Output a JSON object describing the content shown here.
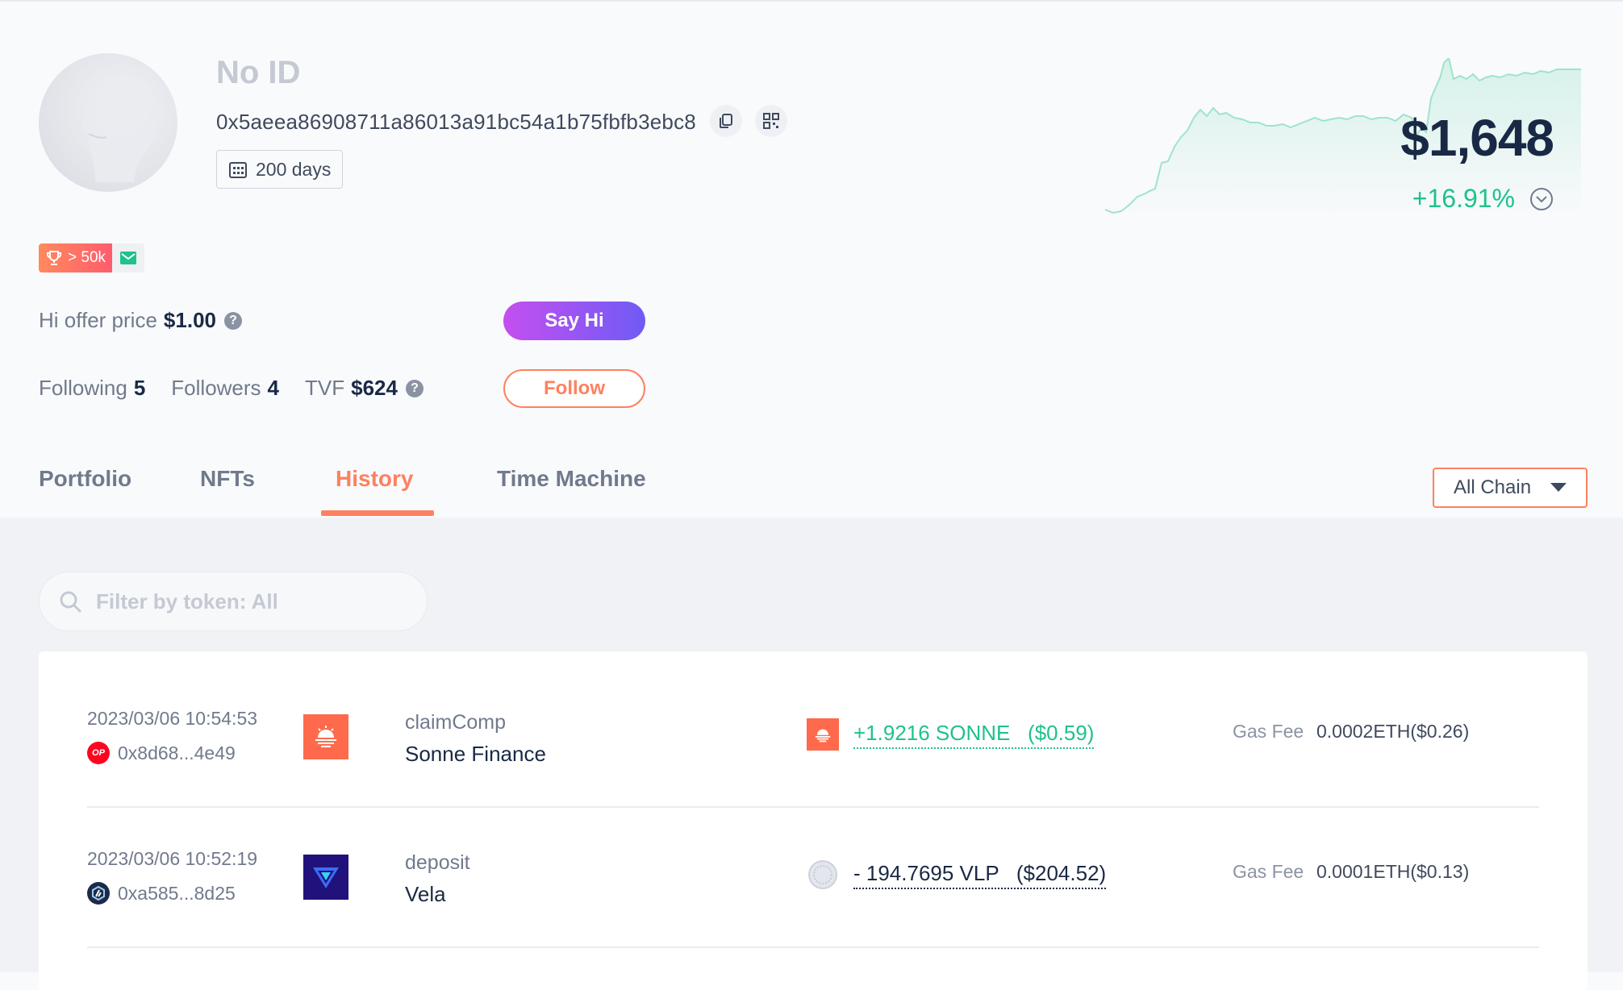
{
  "profile": {
    "name": "No ID",
    "address": "0x5aeea86908711a86013a91bc54a1b75fbfb3ebc8",
    "days": "200 days",
    "rank_badge": "> 50k",
    "hi_offer_label": "Hi offer price",
    "hi_offer_value": "$1.00",
    "following_label": "Following",
    "following_value": "5",
    "followers_label": "Followers",
    "followers_value": "4",
    "tvf_label": "TVF",
    "tvf_value": "$624",
    "say_hi_label": "Say Hi",
    "follow_label": "Follow",
    "help_glyph": "?"
  },
  "networth": {
    "value": "$1,648",
    "change": "+16.91%"
  },
  "tabs": [
    {
      "label": "Portfolio"
    },
    {
      "label": "NFTs"
    },
    {
      "label": "History"
    },
    {
      "label": "Time Machine"
    }
  ],
  "chain_select": {
    "value": "All Chain"
  },
  "search": {
    "placeholder": "Filter by token: All"
  },
  "transactions": [
    {
      "time": "2023/03/06 10:54:53",
      "address": "0x8d68...4e49",
      "chain_badge": "OP",
      "action": "claimComp",
      "project": "Sonne Finance",
      "amount": "+1.9216 SONNE   ($0.59)",
      "gas_label": "Gas Fee",
      "gas_value": "0.0002ETH($0.26)"
    },
    {
      "time": "2023/03/06 10:52:19",
      "address": "0xa585...8d25",
      "chain_badge": "",
      "action": "deposit",
      "project": "Vela",
      "amount": "- 194.7695 VLP   ($204.52)",
      "gas_label": "Gas Fee",
      "gas_value": "0.0001ETH($0.13)"
    }
  ],
  "colors": {
    "accent": "#fe815f",
    "positive": "#1fc28a",
    "text_dark": "#192945"
  },
  "icons": [
    "copy-icon",
    "qrcode-icon",
    "calendar-icon",
    "trophy-icon",
    "mail-icon",
    "help-icon",
    "chevron-down-icon",
    "search-icon",
    "caret-down-icon"
  ]
}
